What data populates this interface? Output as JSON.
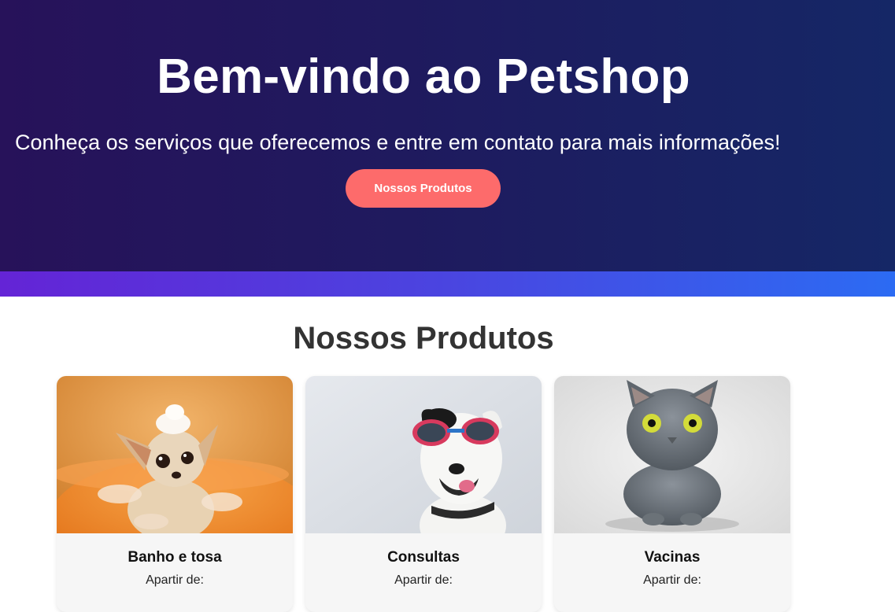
{
  "hero": {
    "title": "Bem-vindo ao Petshop",
    "subtitle": "Conheça os serviços que oferecemos e entre em contato para mais informações!",
    "button_label": "Nossos Produtos"
  },
  "products": {
    "title": "Nossos Produtos",
    "items": [
      {
        "name": "Banho e tosa",
        "price_label": "Apartir de:",
        "image": "chihuahua-bath-photo"
      },
      {
        "name": "Consultas",
        "price_label": "Apartir de:",
        "image": "dog-with-sunglasses-photo"
      },
      {
        "name": "Vacinas",
        "price_label": "Apartir de:",
        "image": "gray-cat-photo"
      }
    ]
  },
  "colors": {
    "hero_bg_start": "#27125a",
    "hero_bg_end": "#152766",
    "button": "#fd6b6b",
    "divider_start": "#6424d6",
    "divider_end": "#2c6bf3"
  }
}
